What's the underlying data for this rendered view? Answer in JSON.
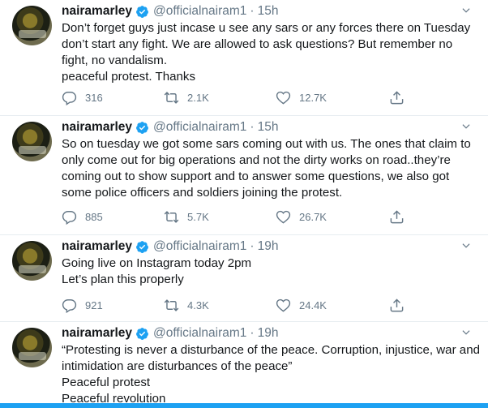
{
  "tweets": [
    {
      "name": "nairamarley",
      "handle": "@officialnairam1",
      "separator": "·",
      "time": "15h",
      "lines": [
        "Don’t forget guys just incase u see any sars or any forces there on Tuesday",
        "don’t start any fight. We are allowed to ask questions? But remember no",
        "fight, no vandalism.",
        "peaceful protest. Thanks"
      ],
      "replies": "316",
      "retweets": "2.1K",
      "likes": "12.7K"
    },
    {
      "name": "nairamarley",
      "handle": "@officialnairam1",
      "separator": "·",
      "time": "15h",
      "lines": [
        "So on tuesday we got some sars coming out with us. The ones that claim to",
        "only come out for big operations and not the dirty works on road..they’re",
        "coming out to show support and to answer some questions, we also got",
        "some police officers and soldiers joining the protest."
      ],
      "replies": "885",
      "retweets": "5.7K",
      "likes": "26.7K"
    },
    {
      "name": "nairamarley",
      "handle": "@officialnairam1",
      "separator": "·",
      "time": "19h",
      "lines": [
        "Going live on Instagram today 2pm",
        "Let’s plan this properly"
      ],
      "replies": "921",
      "retweets": "4.3K",
      "likes": "24.4K"
    },
    {
      "name": "nairamarley",
      "handle": "@officialnairam1",
      "separator": "·",
      "time": "19h",
      "lines": [
        "“Protesting is never a disturbance of the peace. Corruption, injustice, war and",
        "intimidation are disturbances of the peace”",
        "Peaceful protest",
        "Peaceful revolution"
      ]
    }
  ],
  "icons": {
    "verified": "verified-badge-icon",
    "caret": "chevron-down-icon",
    "reply": "reply-icon",
    "retweet": "retweet-icon",
    "like": "heart-icon",
    "share": "share-icon"
  },
  "colors": {
    "accent": "#1da1f2",
    "secondary_text": "#657786",
    "divider": "#e6ecf0"
  }
}
